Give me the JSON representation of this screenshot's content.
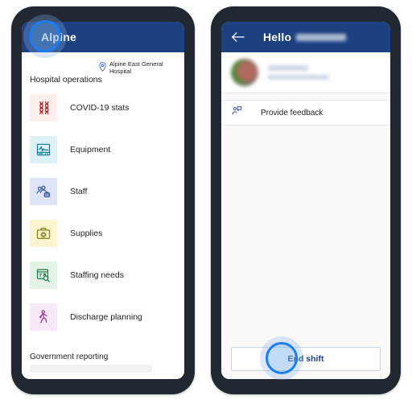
{
  "colors": {
    "appbar_blue": "#1d4081",
    "frame_dark": "#222831",
    "screen_bg": "#faf9f8",
    "cursor_blue": "#1a7ef0"
  },
  "left_phone": {
    "appbar": {
      "title": "Alpine"
    },
    "location": {
      "icon": "location-pin-icon",
      "text": "Alpine East General Hospital"
    },
    "section_title": "Hospital operations",
    "items": [
      {
        "label": "COVID-19 stats",
        "icon": "dna-icon",
        "tile_bg": "#fdeeeb",
        "icon_color": "#a4262c"
      },
      {
        "label": "Equipment",
        "icon": "vitals-monitor-icon",
        "tile_bg": "#dcf0f5",
        "icon_color": "#13788f"
      },
      {
        "label": "Staff",
        "icon": "people-group-icon",
        "tile_bg": "#dfe4f7",
        "icon_color": "#2b4ea3"
      },
      {
        "label": "Supplies",
        "icon": "first-aid-kit-icon",
        "tile_bg": "#fbf4cf",
        "icon_color": "#867f15"
      },
      {
        "label": "Staffing needs",
        "icon": "board-search-icon",
        "tile_bg": "#e3f3e7",
        "icon_color": "#167a3e"
      },
      {
        "label": "Discharge planning",
        "icon": "walking-person-icon",
        "tile_bg": "#f7e9f7",
        "icon_color": "#9b2fa0"
      }
    ],
    "footer_section": "Government reporting"
  },
  "right_phone": {
    "appbar": {
      "back_icon": "back-arrow-icon",
      "greeting": "Hello",
      "name_redacted": true
    },
    "profile": {
      "avatar": "user-avatar",
      "name_redacted": true,
      "subtitle_redacted": true
    },
    "feedback": {
      "icon": "person-feedback-icon",
      "label": "Provide  feedback"
    },
    "end_shift_button": {
      "label": "End shift"
    }
  },
  "cursors": [
    {
      "name": "cursor-left-appbar"
    },
    {
      "name": "cursor-end-shift"
    }
  ]
}
